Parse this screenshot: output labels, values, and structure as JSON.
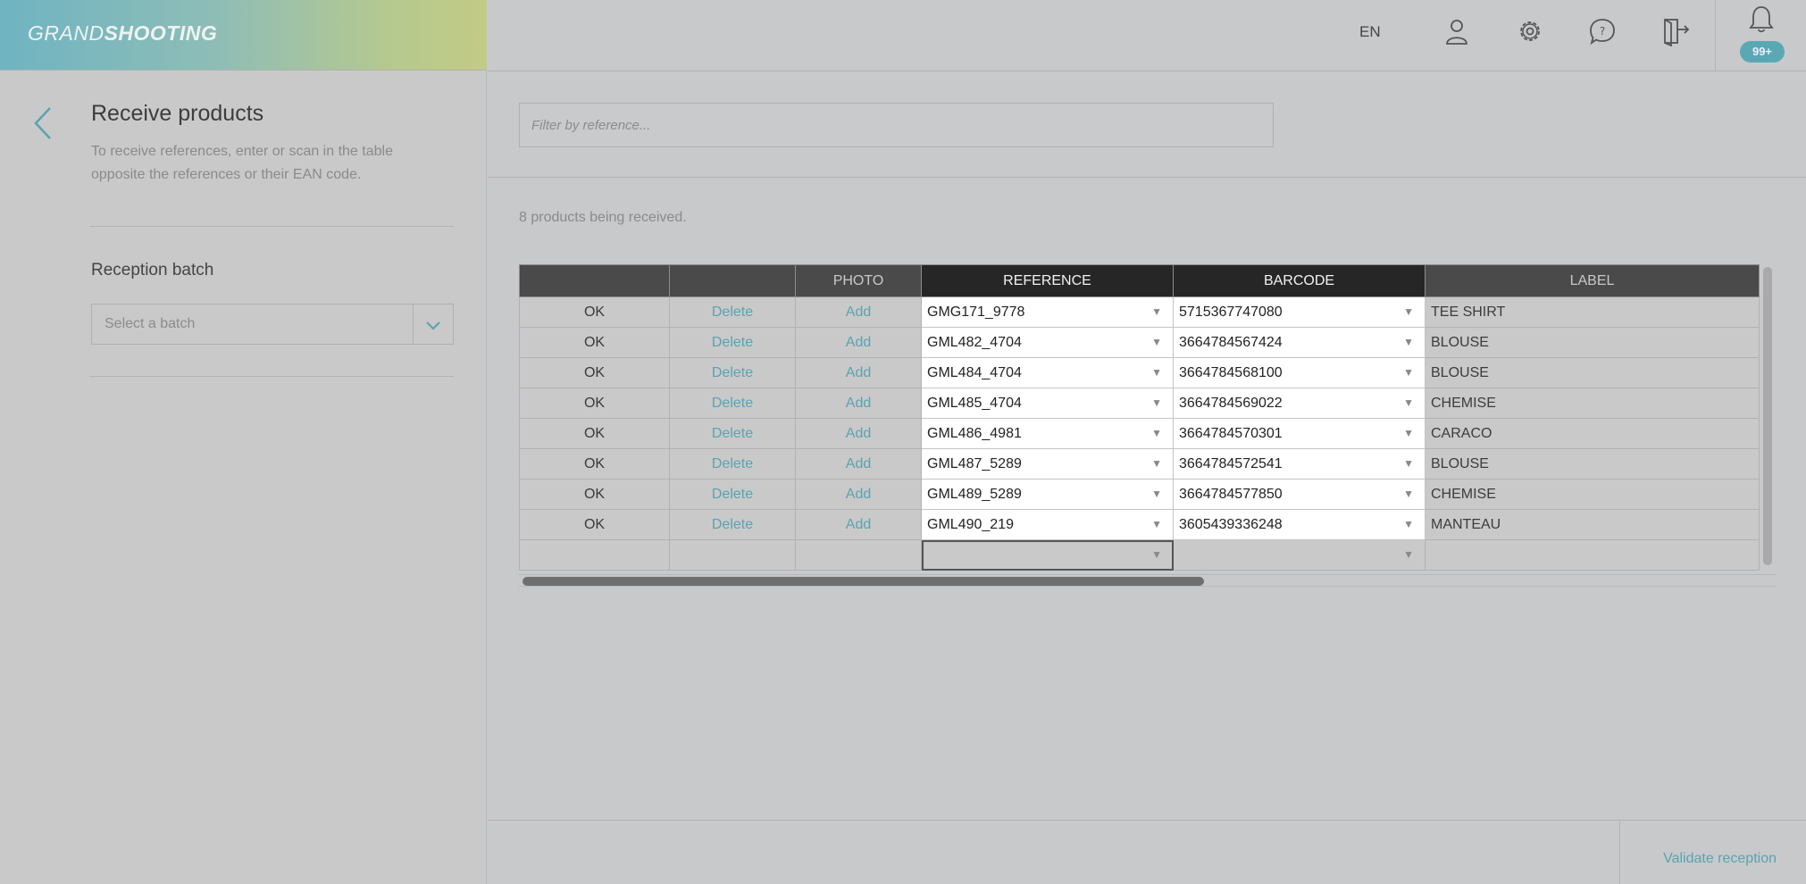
{
  "app": {
    "logo_light": "GRAND",
    "logo_bold": "SHOOTING"
  },
  "header": {
    "language": "EN",
    "notification_badge": "99+"
  },
  "sidebar": {
    "title": "Receive products",
    "description": "To receive references, enter or scan in the table opposite the references or their EAN code.",
    "batch_label": "Reception batch",
    "batch_placeholder": "Select a batch"
  },
  "filter": {
    "placeholder": "Filter by reference..."
  },
  "status": {
    "count_text": "8 products being received."
  },
  "table": {
    "headers": [
      "",
      "",
      "PHOTO",
      "REFERENCE",
      "BARCODE",
      "LABEL"
    ],
    "rows": [
      {
        "status": "OK",
        "delete": "Delete",
        "photo": "Add",
        "reference": "GMG171_9778",
        "barcode": "5715367747080",
        "label": "TEE SHIRT"
      },
      {
        "status": "OK",
        "delete": "Delete",
        "photo": "Add",
        "reference": "GML482_4704",
        "barcode": "3664784567424",
        "label": "BLOUSE"
      },
      {
        "status": "OK",
        "delete": "Delete",
        "photo": "Add",
        "reference": "GML484_4704",
        "barcode": "3664784568100",
        "label": "BLOUSE"
      },
      {
        "status": "OK",
        "delete": "Delete",
        "photo": "Add",
        "reference": "GML485_4704",
        "barcode": "3664784569022",
        "label": "CHEMISE"
      },
      {
        "status": "OK",
        "delete": "Delete",
        "photo": "Add",
        "reference": "GML486_4981",
        "barcode": "3664784570301",
        "label": "CARACO"
      },
      {
        "status": "OK",
        "delete": "Delete",
        "photo": "Add",
        "reference": "GML487_5289",
        "barcode": "3664784572541",
        "label": "BLOUSE"
      },
      {
        "status": "OK",
        "delete": "Delete",
        "photo": "Add",
        "reference": "GML489_5289",
        "barcode": "3664784577850",
        "label": "CHEMISE"
      },
      {
        "status": "OK",
        "delete": "Delete",
        "photo": "Add",
        "reference": "GML490_219",
        "barcode": "3605439336248",
        "label": "MANTEAU"
      }
    ]
  },
  "footer": {
    "validate_label": "Validate reception"
  },
  "colors": {
    "accent": "#5aa3b0",
    "badge": "#5aa8b4",
    "header_dark": "#262626",
    "header_dim": "#4a4a4a"
  },
  "icons": [
    "back-arrow-icon",
    "user-icon",
    "settings-gear-icon",
    "help-bubble-icon",
    "logout-door-icon",
    "bell-icon",
    "chevron-down-icon",
    "dropdown-arrow-icon"
  ]
}
